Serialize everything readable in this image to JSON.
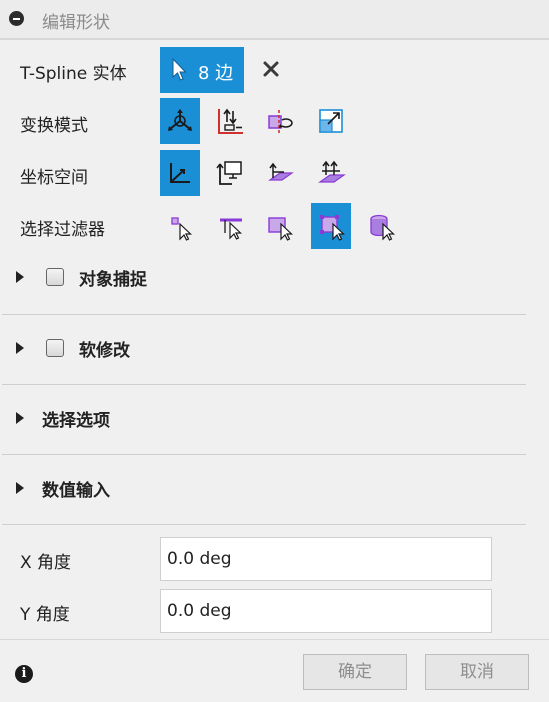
{
  "header": {
    "title": "编辑形状",
    "collapse_icon": "minus-circle-icon"
  },
  "rows": {
    "tspline": {
      "label": "T-Spline 实体",
      "selection_button": "8 边",
      "clear_icon": "close-icon"
    },
    "transform_mode": {
      "label": "变换模式",
      "tools": [
        "multi-transform-icon",
        "translate-axes-icon",
        "rotate-icon",
        "scale-icon"
      ],
      "active_index": 0
    },
    "coordinate_space": {
      "label": "坐标空间",
      "tools": [
        "world-space-icon",
        "view-space-icon",
        "local-space-icon",
        "parent-space-icon"
      ],
      "active_index": 0
    },
    "selection_filter": {
      "label": "选择过滤器",
      "tools": [
        "vertex-filter-icon",
        "edge-filter-icon",
        "face-filter-icon",
        "all-filter-icon",
        "body-filter-icon"
      ],
      "active_index": 3
    }
  },
  "sections": [
    {
      "label": "对象捕捉",
      "has_checkbox": true,
      "checked": false
    },
    {
      "label": "软修改",
      "has_checkbox": true,
      "checked": false
    },
    {
      "label": "选择选项",
      "has_checkbox": false
    },
    {
      "label": "数值输入",
      "has_checkbox": false
    }
  ],
  "fields": {
    "x_angle": {
      "label": "X 角度",
      "value": "0.0 deg"
    },
    "y_angle": {
      "label": "Y 角度",
      "value": "0.0 deg"
    }
  },
  "footer": {
    "ok_label": "确定",
    "cancel_label": "取消",
    "info_icon": "info-icon"
  },
  "colors": {
    "accent": "#1b8fd6",
    "background": "#f0f0f0",
    "purple": "#8a3ad6",
    "red": "#d0312d"
  }
}
